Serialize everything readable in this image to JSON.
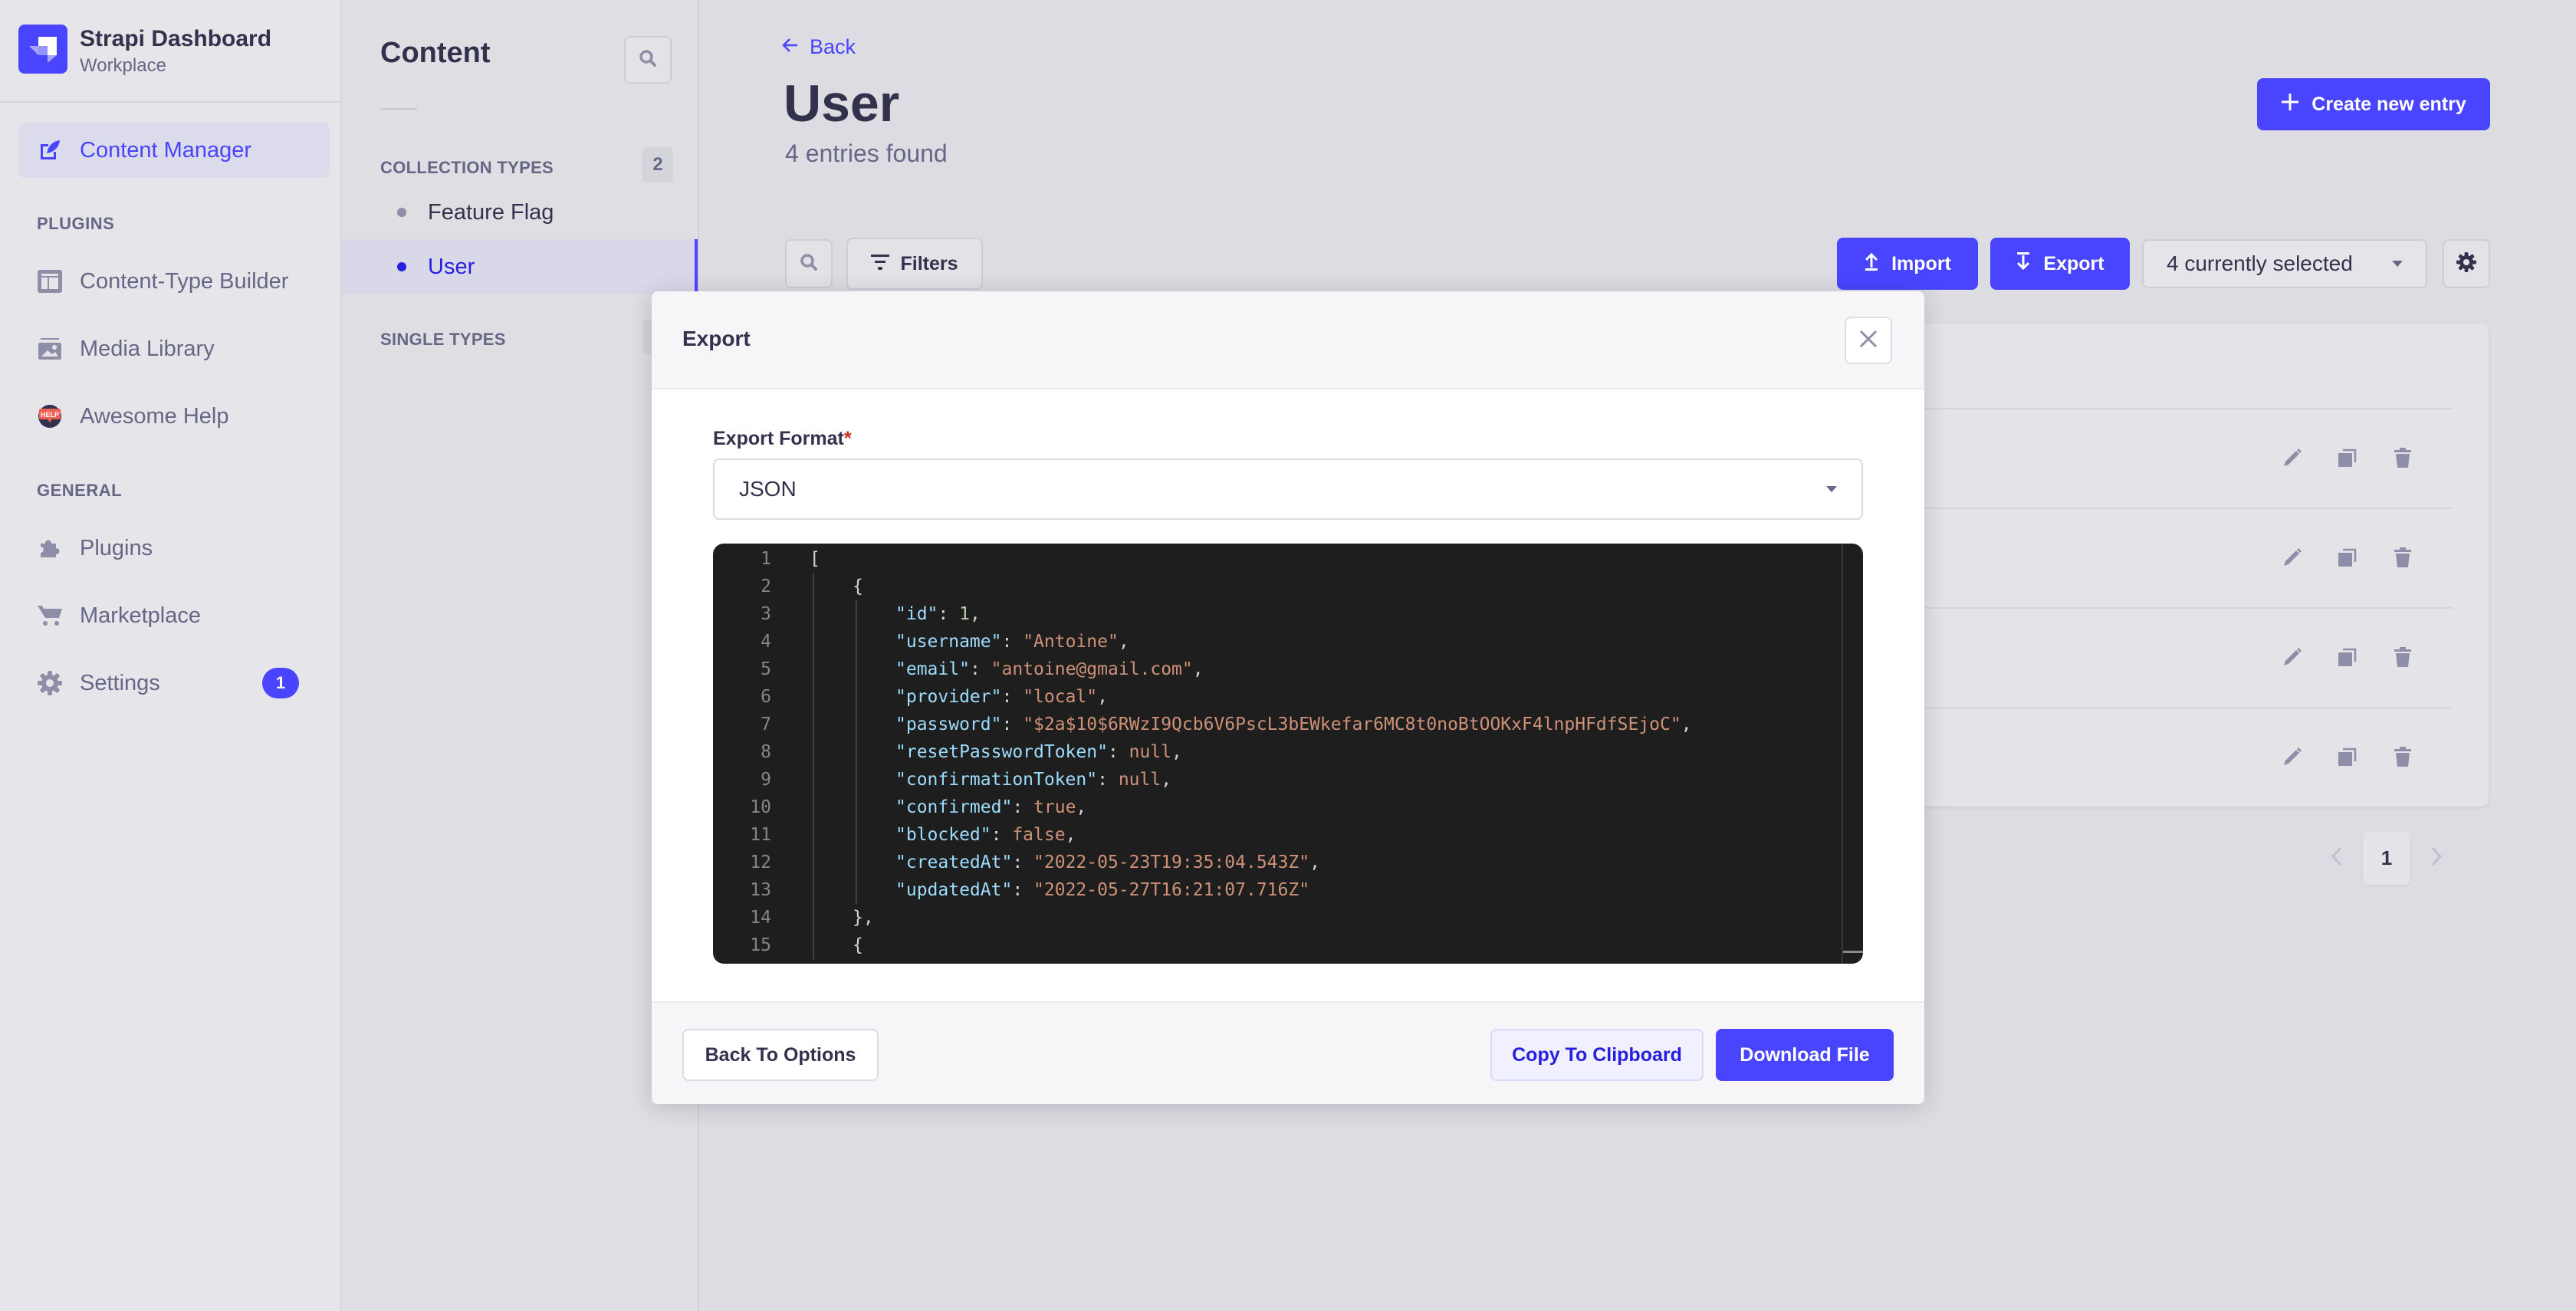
{
  "brand": {
    "title": "Strapi Dashboard",
    "subtitle": "Workplace",
    "logo_icon": "strapi-logo-icon",
    "accent_color": "#4945ff"
  },
  "sidebar": {
    "active_item": {
      "label": "Content Manager",
      "icon": "feather-edit-icon"
    },
    "sections": [
      {
        "title": "PLUGINS",
        "items": [
          {
            "label": "Content-Type Builder",
            "icon": "layout-icon"
          },
          {
            "label": "Media Library",
            "icon": "image-icon"
          },
          {
            "label": "Awesome Help",
            "icon": "help-badge-icon"
          }
        ]
      },
      {
        "title": "GENERAL",
        "items": [
          {
            "label": "Plugins",
            "icon": "puzzle-icon"
          },
          {
            "label": "Marketplace",
            "icon": "cart-icon"
          },
          {
            "label": "Settings",
            "icon": "gear-icon",
            "badge": "1"
          }
        ]
      }
    ]
  },
  "content_nav": {
    "title": "Content",
    "search_icon": "search-icon",
    "collection_types": {
      "title": "COLLECTION TYPES",
      "count": "2",
      "items": [
        {
          "label": "Feature Flag",
          "active": false
        },
        {
          "label": "User",
          "active": true
        }
      ]
    },
    "single_types": {
      "title": "SINGLE TYPES"
    }
  },
  "main": {
    "back_label": "Back",
    "title": "User",
    "subtitle": "4 entries found",
    "create_button": "Create new entry",
    "filters_button": "Filters",
    "import_button": "Import",
    "export_button": "Export",
    "selection_select": "4 currently selected",
    "row_actions": [
      "edit-icon",
      "duplicate-icon",
      "delete-icon"
    ],
    "row_count": 4,
    "pagination": {
      "current_page": "1"
    }
  },
  "modal": {
    "title": "Export",
    "format_label": "Export Format",
    "required_mark": "*",
    "format_value": "JSON",
    "code_lines": [
      {
        "n": "1",
        "indent": 0,
        "tokens": [
          [
            "p",
            "["
          ]
        ]
      },
      {
        "n": "2",
        "indent": 1,
        "tokens": [
          [
            "p",
            "{"
          ]
        ]
      },
      {
        "n": "3",
        "indent": 2,
        "tokens": [
          [
            "k",
            "\"id\""
          ],
          [
            "p",
            ": "
          ],
          [
            "n",
            "1"
          ],
          [
            "p",
            ","
          ]
        ]
      },
      {
        "n": "4",
        "indent": 2,
        "tokens": [
          [
            "k",
            "\"username\""
          ],
          [
            "p",
            ": "
          ],
          [
            "s",
            "\"Antoine\""
          ],
          [
            "p",
            ","
          ]
        ]
      },
      {
        "n": "5",
        "indent": 2,
        "tokens": [
          [
            "k",
            "\"email\""
          ],
          [
            "p",
            ": "
          ],
          [
            "s",
            "\"antoine@gmail.com\""
          ],
          [
            "p",
            ","
          ]
        ]
      },
      {
        "n": "6",
        "indent": 2,
        "tokens": [
          [
            "k",
            "\"provider\""
          ],
          [
            "p",
            ": "
          ],
          [
            "s",
            "\"local\""
          ],
          [
            "p",
            ","
          ]
        ]
      },
      {
        "n": "7",
        "indent": 2,
        "tokens": [
          [
            "k",
            "\"password\""
          ],
          [
            "p",
            ": "
          ],
          [
            "s",
            "\"$2a$10$6RWzI9Qcb6V6PscL3bEWkefar6MC8t0noBtOOKxF4lnpHFdfSEjoC\""
          ],
          [
            "p",
            ","
          ]
        ]
      },
      {
        "n": "8",
        "indent": 2,
        "tokens": [
          [
            "k",
            "\"resetPasswordToken\""
          ],
          [
            "p",
            ": "
          ],
          [
            "s",
            "null"
          ],
          [
            "p",
            ","
          ]
        ]
      },
      {
        "n": "9",
        "indent": 2,
        "tokens": [
          [
            "k",
            "\"confirmationToken\""
          ],
          [
            "p",
            ": "
          ],
          [
            "s",
            "null"
          ],
          [
            "p",
            ","
          ]
        ]
      },
      {
        "n": "10",
        "indent": 2,
        "tokens": [
          [
            "k",
            "\"confirmed\""
          ],
          [
            "p",
            ": "
          ],
          [
            "s",
            "true"
          ],
          [
            "p",
            ","
          ]
        ]
      },
      {
        "n": "11",
        "indent": 2,
        "tokens": [
          [
            "k",
            "\"blocked\""
          ],
          [
            "p",
            ": "
          ],
          [
            "s",
            "false"
          ],
          [
            "p",
            ","
          ]
        ]
      },
      {
        "n": "12",
        "indent": 2,
        "tokens": [
          [
            "k",
            "\"createdAt\""
          ],
          [
            "p",
            ": "
          ],
          [
            "s",
            "\"2022-05-23T19:35:04.543Z\""
          ],
          [
            "p",
            ","
          ]
        ]
      },
      {
        "n": "13",
        "indent": 2,
        "tokens": [
          [
            "k",
            "\"updatedAt\""
          ],
          [
            "p",
            ": "
          ],
          [
            "s",
            "\"2022-05-27T16:21:07.716Z\""
          ]
        ]
      },
      {
        "n": "14",
        "indent": 1,
        "tokens": [
          [
            "p",
            "},"
          ]
        ]
      },
      {
        "n": "15",
        "indent": 1,
        "tokens": [
          [
            "p",
            "{"
          ]
        ]
      }
    ],
    "back_button": "Back To Options",
    "copy_button": "Copy To Clipboard",
    "download_button": "Download File",
    "close_icon": "close-icon"
  }
}
